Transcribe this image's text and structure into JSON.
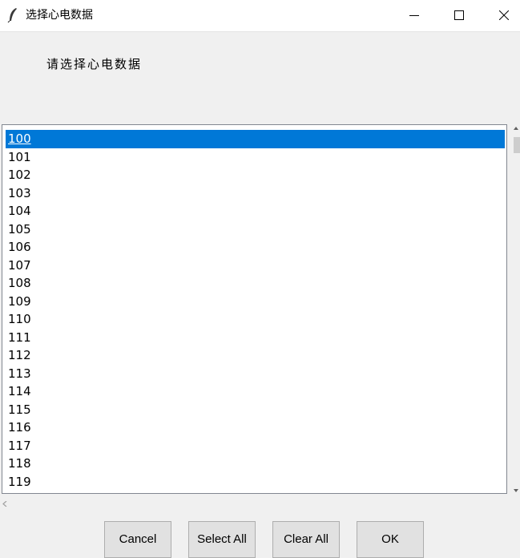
{
  "window": {
    "title": "选择心电数据",
    "icon": "feather-icon",
    "controls": [
      "minimize-icon",
      "maximize-icon",
      "close-icon"
    ]
  },
  "prompt": "请选择心电数据",
  "listbox": {
    "items": [
      "100",
      "101",
      "102",
      "103",
      "104",
      "105",
      "106",
      "107",
      "108",
      "109",
      "110",
      "111",
      "112",
      "113",
      "114",
      "115",
      "116",
      "117",
      "118",
      "119"
    ],
    "selected_index": 0,
    "selection_color": "#0078d7"
  },
  "buttons": {
    "cancel": "Cancel",
    "select_all": "Select All",
    "clear_all": "Clear All",
    "ok": "OK"
  }
}
